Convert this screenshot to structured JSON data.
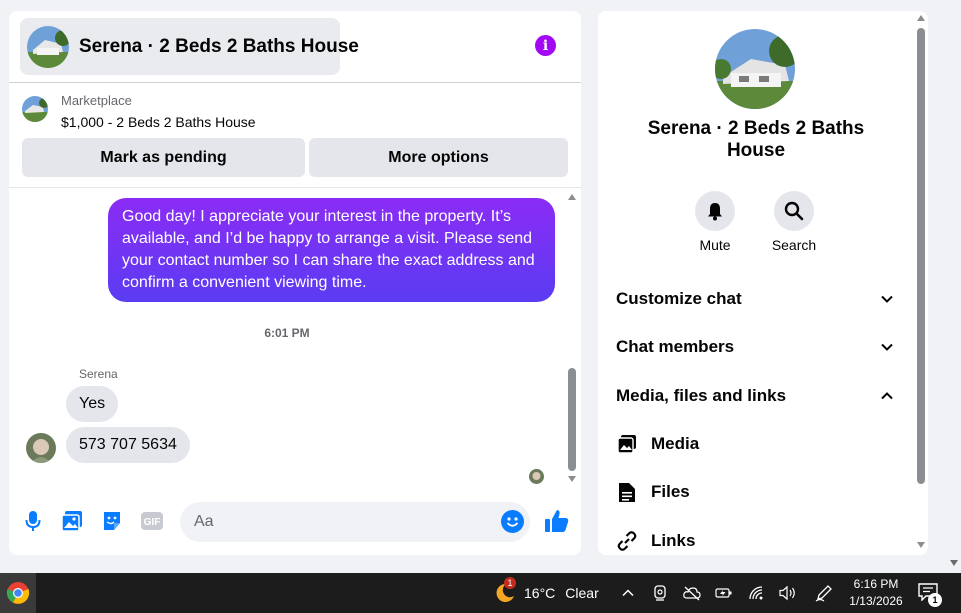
{
  "chat": {
    "title": "Serena · 2 Beds 2 Baths House",
    "marketplace_label": "Marketplace",
    "listing": "$1,000 - 2 Beds 2 Baths House",
    "btn_pending": "Mark as pending",
    "btn_more": "More options",
    "outgoing_message": "Good day! I appreciate your interest in the property. It’s available, and I’d be happy to arrange a visit. Please send your contact number so I can share the exact address and confirm a convenient viewing time.",
    "timestamp": "6:01 PM",
    "sender_name": "Serena",
    "incoming_messages": [
      "Yes",
      "573 707 5634"
    ],
    "input_placeholder": "Aa",
    "gif_label": "GIF"
  },
  "info": {
    "name": "Serena · 2 Beds 2 Baths House",
    "mute_label": "Mute",
    "search_label": "Search",
    "sections": [
      "Customize chat",
      "Chat members",
      "Media, files and links"
    ],
    "sub_items": [
      "Media",
      "Files",
      "Links"
    ]
  },
  "taskbar": {
    "weather_temp": "16°C",
    "weather_cond": "Clear",
    "weather_badge": "1",
    "time": "6:16 PM",
    "date": "1/13/2026",
    "notification_count": "1"
  },
  "colors": {
    "accent": "#0a7cff",
    "info_icon": "#a20af5",
    "bubble_out_top": "#8b2cf5",
    "bubble_out_bottom": "#5a3cf2"
  }
}
